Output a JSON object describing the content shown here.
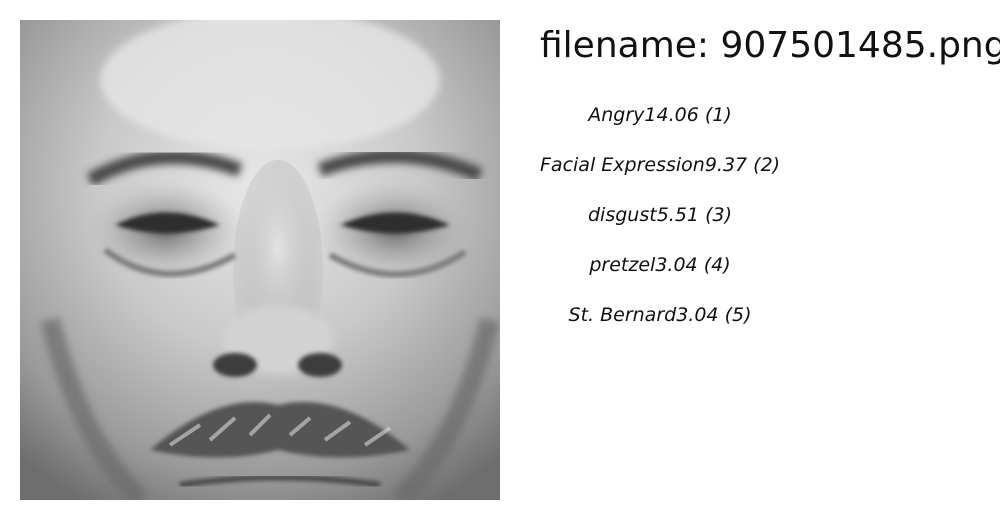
{
  "header": {
    "filename_label": "filename: 907501485.png"
  },
  "image": {
    "subject": "grayscale close-up photograph of a man's face with mustache",
    "colors": {
      "background": "#ffffff",
      "text": "#111111",
      "skin_light": "#d8d8d8",
      "skin_mid": "#a8a8a8",
      "skin_dark": "#5a5a5a"
    }
  },
  "predictions": [
    {
      "label": "Angry",
      "score": "14.06",
      "rank": "(1)"
    },
    {
      "label": "Facial Expression",
      "score": "9.37",
      "rank": "(2)"
    },
    {
      "label": "disgust",
      "score": "5.51",
      "rank": "(3)"
    },
    {
      "label": "pretzel",
      "score": "3.04",
      "rank": "(4)"
    },
    {
      "label": "St. Bernard",
      "score": "3.04",
      "rank": "(5)"
    }
  ]
}
